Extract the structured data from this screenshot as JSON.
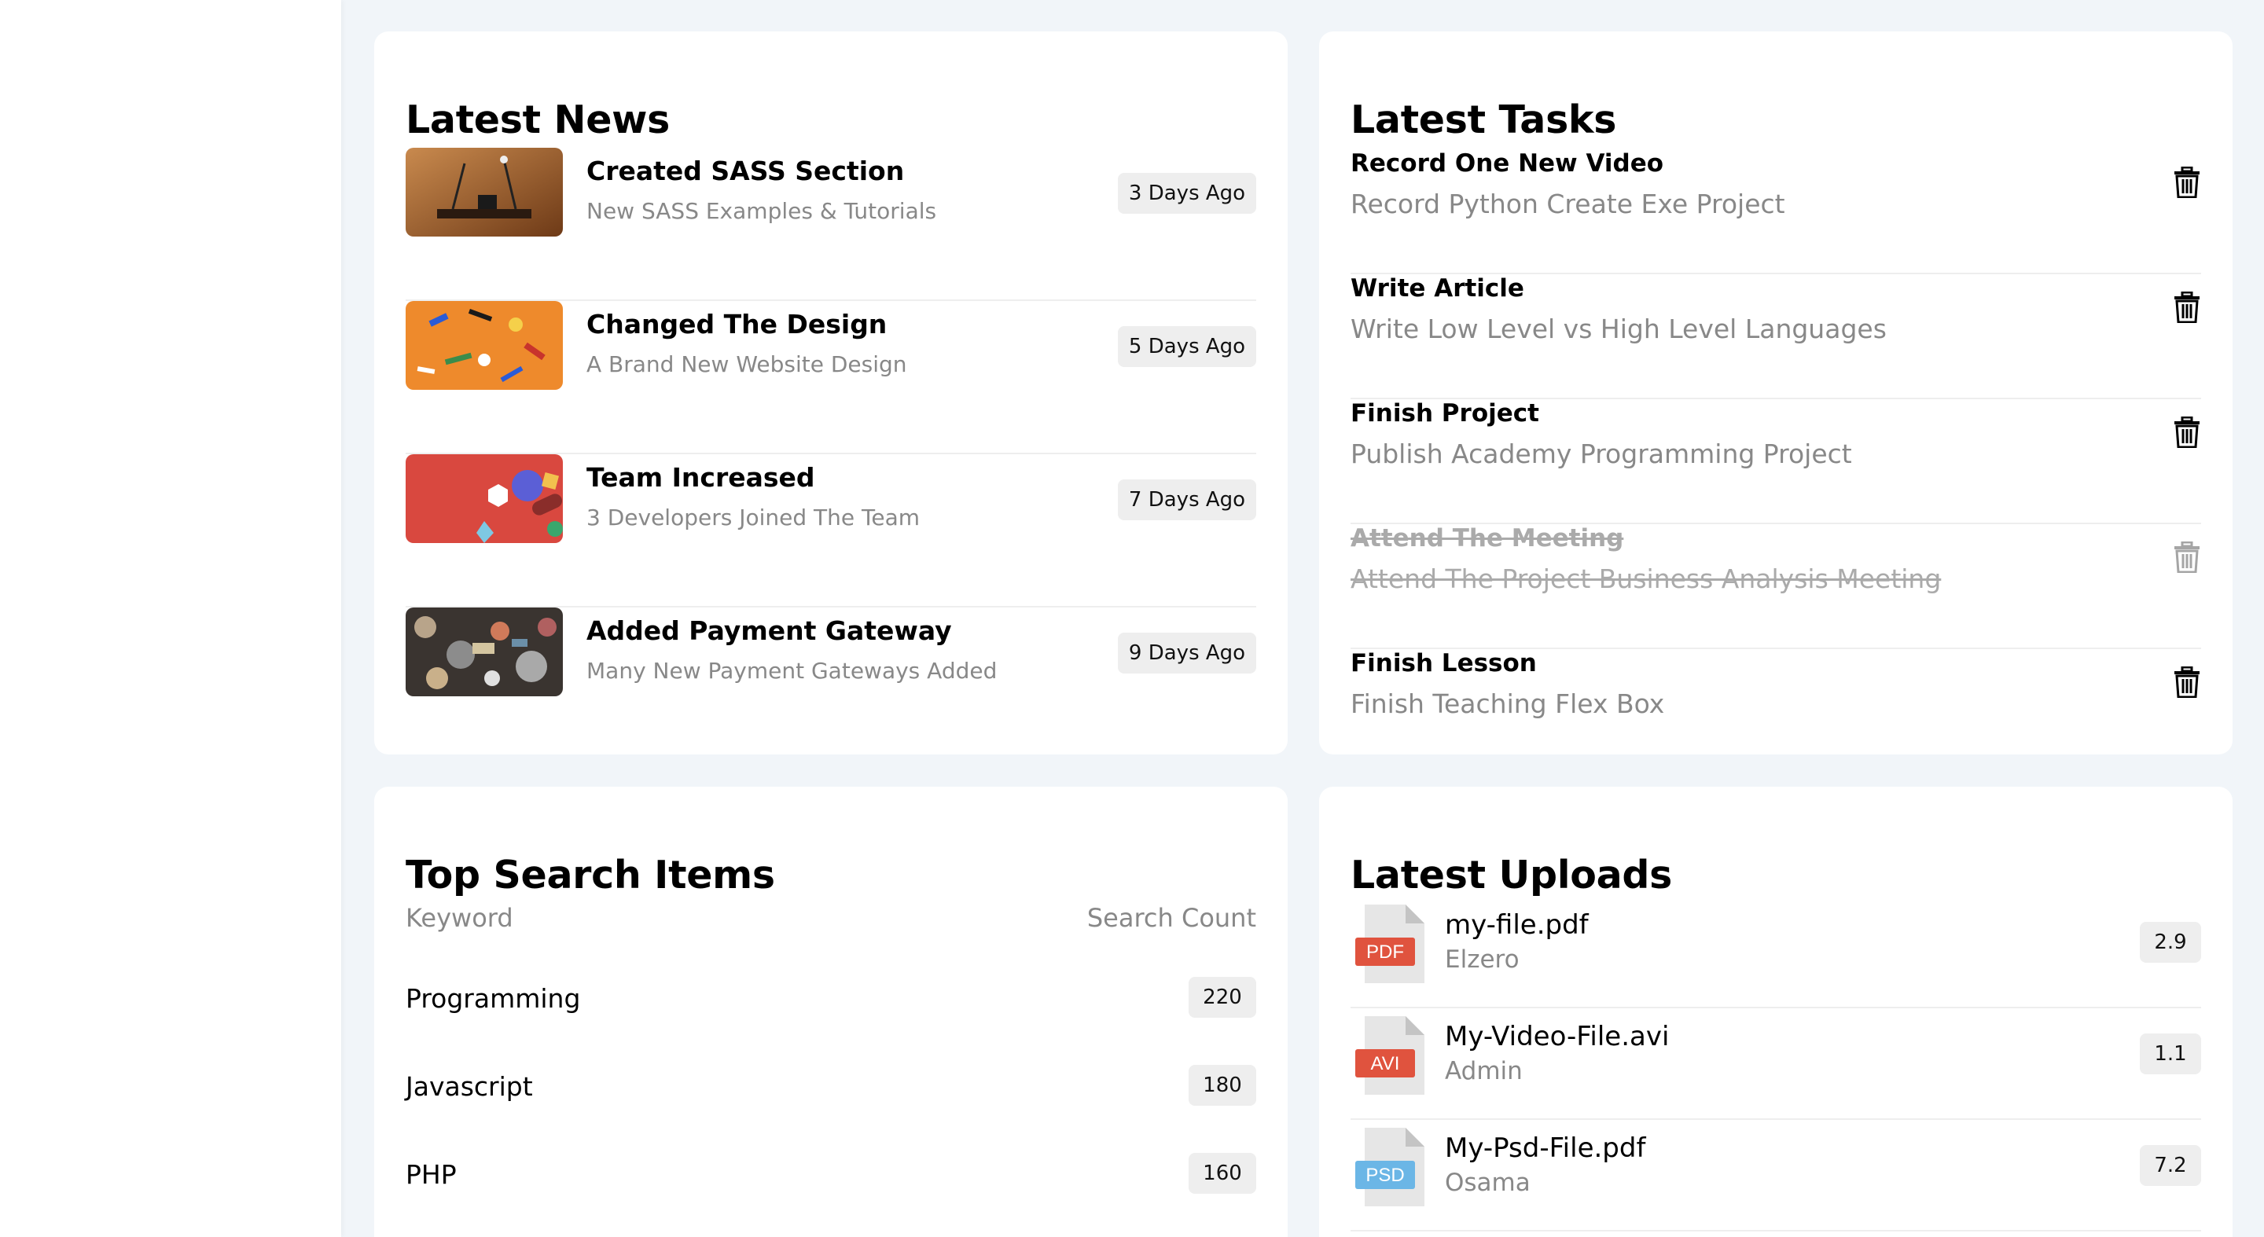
{
  "news": {
    "title": "Latest News",
    "items": [
      {
        "title": "Created SASS Section",
        "subtitle": "New SASS Examples & Tutorials",
        "time": "3 Days Ago"
      },
      {
        "title": "Changed The Design",
        "subtitle": "A Brand New Website Design",
        "time": "5 Days Ago"
      },
      {
        "title": "Team Increased",
        "subtitle": "3 Developers Joined The Team",
        "time": "7 Days Ago"
      },
      {
        "title": "Added Payment Gateway",
        "subtitle": "Many New Payment Gateways Added",
        "time": "9 Days Ago"
      }
    ]
  },
  "tasks": {
    "title": "Latest Tasks",
    "items": [
      {
        "title": "Record One New Video",
        "subtitle": "Record Python Create Exe Project",
        "done": false
      },
      {
        "title": "Write Article",
        "subtitle": "Write Low Level vs High Level Languages",
        "done": false
      },
      {
        "title": "Finish Project",
        "subtitle": "Publish Academy Programming Project",
        "done": false
      },
      {
        "title": "Attend The Meeting",
        "subtitle": "Attend The Project Business Analysis Meeting",
        "done": true
      },
      {
        "title": "Finish Lesson",
        "subtitle": "Finish Teaching Flex Box",
        "done": false
      }
    ]
  },
  "search": {
    "title": "Top Search Items",
    "col_keyword": "Keyword",
    "col_count": "Search Count",
    "rows": [
      {
        "keyword": "Programming",
        "count": "220"
      },
      {
        "keyword": "Javascript",
        "count": "180"
      },
      {
        "keyword": "PHP",
        "count": "160"
      }
    ]
  },
  "uploads": {
    "title": "Latest Uploads",
    "items": [
      {
        "name": "my-file.pdf",
        "owner": "Elzero",
        "size": "2.9",
        "type": "PDF",
        "color": "#e0533e"
      },
      {
        "name": "My-Video-File.avi",
        "owner": "Admin",
        "size": "1.1",
        "type": "AVI",
        "color": "#e0533e"
      },
      {
        "name": "My-Psd-File.pdf",
        "owner": "Osama",
        "size": "7.2",
        "type": "PSD",
        "color": "#6bb6e6"
      }
    ]
  }
}
